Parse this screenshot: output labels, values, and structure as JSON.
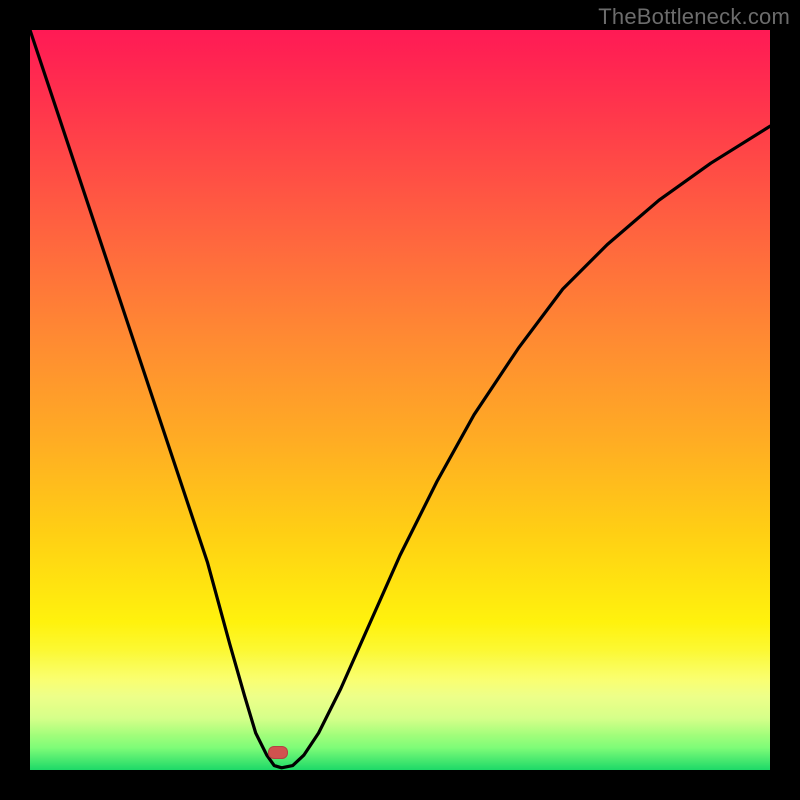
{
  "watermark": "TheBottleneck.com",
  "chart_data": {
    "type": "line",
    "title": "",
    "xlabel": "",
    "ylabel": "",
    "xlim": [
      0,
      100
    ],
    "ylim": [
      0,
      100
    ],
    "series": [
      {
        "name": "bottleneck-curve",
        "x": [
          0,
          4,
          8,
          12,
          16,
          20,
          24,
          27,
          29,
          30.5,
          32,
          33,
          34,
          35.5,
          37,
          39,
          42,
          46,
          50,
          55,
          60,
          66,
          72,
          78,
          85,
          92,
          100
        ],
        "y": [
          100,
          88,
          76,
          64,
          52,
          40,
          28,
          17,
          10,
          5,
          2,
          0.6,
          0.3,
          0.6,
          2,
          5,
          11,
          20,
          29,
          39,
          48,
          57,
          65,
          71,
          77,
          82,
          87
        ]
      }
    ],
    "min_marker": {
      "x": 33.5,
      "y_pct_from_top": 97.6
    },
    "background_gradient": {
      "top": "#ff1a55",
      "mid": "#ffcf14",
      "bottom": "#1dd968"
    }
  }
}
